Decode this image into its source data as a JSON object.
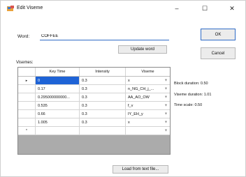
{
  "window": {
    "title": "Edit Viseme",
    "minimize": "–",
    "maximize": "☐",
    "close": "✕"
  },
  "form": {
    "word_label": "Word:",
    "word_value": "COFFEE",
    "update_word": "Update word",
    "ok": "OK",
    "cancel": "Cancel",
    "visemes_label": "Visemes:",
    "load_file": "Load from text file..."
  },
  "grid": {
    "headers": [
      "",
      "Key Time",
      "Intensity",
      "Viseme"
    ],
    "rows": [
      {
        "marker": "▸",
        "key_time": "0",
        "intensity": "0.3",
        "viseme": "x"
      },
      {
        "marker": "",
        "key_time": "0.17",
        "intensity": "0.3",
        "viseme": "n_NG_CH_j_..."
      },
      {
        "marker": "",
        "key_time": "0.295000000000...",
        "intensity": "0.3",
        "viseme": "AA_AO_OW"
      },
      {
        "marker": "",
        "key_time": "0.535",
        "intensity": "0.3",
        "viseme": "f_v"
      },
      {
        "marker": "",
        "key_time": "0.66",
        "intensity": "0.3",
        "viseme": "IY_EH_y"
      },
      {
        "marker": "",
        "key_time": "1.005",
        "intensity": "0.3",
        "viseme": "x"
      },
      {
        "marker": "*",
        "key_time": "",
        "intensity": "",
        "viseme": ""
      }
    ]
  },
  "info": {
    "block_duration": "Block duration: 0.50",
    "viseme_duration": "Viseme duration: 1.01",
    "time_scale": "Time scale: 0.50"
  }
}
